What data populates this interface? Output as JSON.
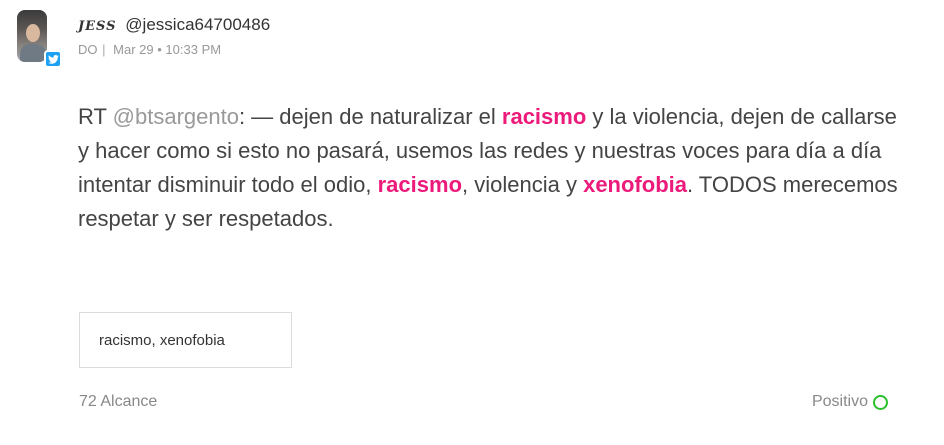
{
  "author": {
    "name": "JESS",
    "handle": "@jessica64700486",
    "avatar_alt": "user-avatar",
    "network_icon": "twitter-icon"
  },
  "meta": {
    "country": "DO",
    "separator": "|",
    "date": "Mar 29",
    "dot": "•",
    "time": "10:33 PM"
  },
  "post": {
    "segments": [
      {
        "text": "RT ",
        "kind": "plain"
      },
      {
        "text": "@btsargento",
        "kind": "mention"
      },
      {
        "text": ": — dejen de naturalizar el ",
        "kind": "plain"
      },
      {
        "text": "racismo",
        "kind": "keyword"
      },
      {
        "text": " y la violencia, dejen de callarse y hacer como si esto no pasará, usemos las redes y nuestras voces para día a día intentar disminuir todo el odio, ",
        "kind": "plain"
      },
      {
        "text": "racismo",
        "kind": "keyword"
      },
      {
        "text": ", violencia y ",
        "kind": "plain"
      },
      {
        "text": "xenofobia",
        "kind": "keyword"
      },
      {
        "text": ". TODOS merecemos respetar y ser respetados.",
        "kind": "plain"
      }
    ]
  },
  "tags": {
    "label": "racismo, xenofobia"
  },
  "stats": {
    "reach": "72 Alcance",
    "sentiment": "Positivo",
    "sentiment_color": "#2cc02c"
  },
  "colors": {
    "keyword": "#ec1a7a",
    "twitter": "#1da1f2"
  }
}
